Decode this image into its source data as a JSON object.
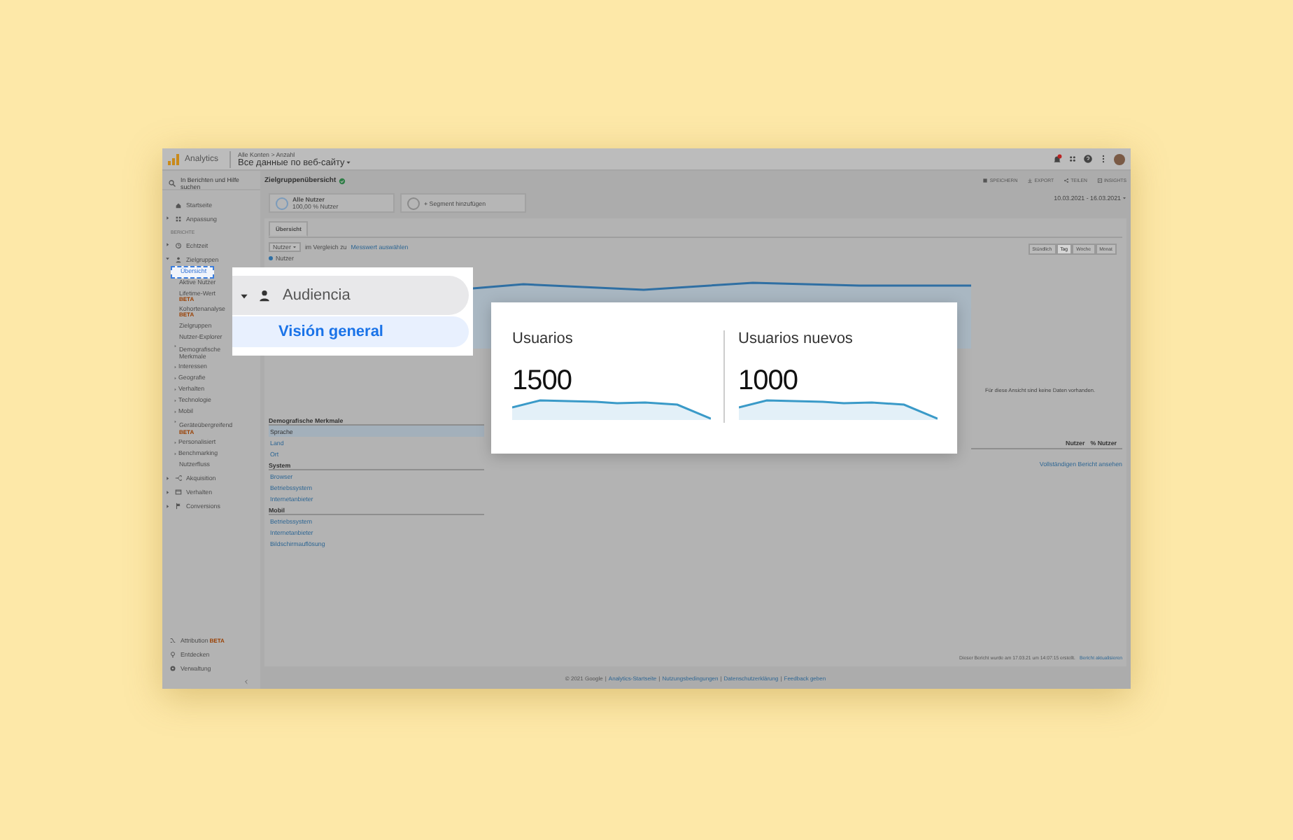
{
  "topbar": {
    "app_name": "Analytics",
    "breadcrumb": "Alle Konten > Anzahl",
    "property": "Все данные по веб-сайту"
  },
  "search": {
    "placeholder": "In Berichten und Hilfe suchen"
  },
  "sidebar": {
    "items": [
      {
        "kind": "item",
        "label": "Startseite",
        "selected": false
      },
      {
        "kind": "item",
        "label": "Anpassung",
        "expanded": false,
        "selected": false
      },
      {
        "kind": "section",
        "label": "BERICHTE"
      },
      {
        "kind": "item",
        "label": "Echtzeit",
        "expanded": false,
        "selected": false
      },
      {
        "kind": "item",
        "label": "Zielgruppen",
        "expanded": true,
        "selected": false,
        "children": [
          {
            "label": "Übersicht",
            "selected": true
          },
          {
            "label": "Aktive Nutzer",
            "selected": false
          },
          {
            "label": "Lifetime-Wert",
            "badge": "BETA",
            "selected": false
          },
          {
            "label": "Kohortenanalyse",
            "badge": "BETA",
            "selected": false
          },
          {
            "label": "Zielgruppen",
            "selected": false
          },
          {
            "label": "Nutzer-Explorer",
            "selected": false
          },
          {
            "label": "Demografische Merkmale",
            "expanded": false,
            "selected": false
          },
          {
            "label": "Interessen",
            "expanded": false,
            "selected": false
          },
          {
            "label": "Geografie",
            "expanded": false,
            "selected": false
          },
          {
            "label": "Verhalten",
            "expanded": false,
            "selected": false
          },
          {
            "label": "Technologie",
            "expanded": false,
            "selected": false
          },
          {
            "label": "Mobil",
            "expanded": false,
            "selected": false
          },
          {
            "label": "Geräteübergreifend",
            "badge": "BETA",
            "expanded": false,
            "selected": false
          },
          {
            "label": "Personalisiert",
            "expanded": false,
            "selected": false
          },
          {
            "label": "Benchmarking",
            "expanded": false,
            "selected": false
          },
          {
            "label": "Nutzerfluss",
            "selected": false
          }
        ]
      },
      {
        "kind": "item",
        "label": "Akquisition",
        "expanded": false,
        "selected": false
      },
      {
        "kind": "item",
        "label": "Verhalten",
        "expanded": false,
        "selected": false
      },
      {
        "kind": "item",
        "label": "Conversions",
        "expanded": false,
        "selected": false
      }
    ],
    "bottom": [
      {
        "label": "Attribution",
        "badge": "BETA"
      },
      {
        "label": "Entdecken"
      },
      {
        "label": "Verwaltung"
      }
    ]
  },
  "report": {
    "title": "Zielgruppenübersicht",
    "verified": true,
    "actions": [
      {
        "label": "SPEICHERN"
      },
      {
        "label": "EXPORT"
      },
      {
        "label": "TEILEN"
      },
      {
        "label": "INSIGHTS"
      }
    ],
    "date_range": "10.03.2021 - 16.03.2021"
  },
  "segments": [
    {
      "kind": "segment",
      "name": "Alle Nutzer",
      "detail": "100,00 % Nutzer"
    },
    {
      "kind": "add",
      "name": "+ Segment hinzufügen"
    }
  ],
  "tabs": [
    {
      "label": "Übersicht",
      "selected": true
    }
  ],
  "metric_select": {
    "value": "Nutzer",
    "compare_text": "im Vergleich zu",
    "compare_link": "Messwert auswählen"
  },
  "legend": "Nutzer",
  "granularity": [
    {
      "label": "Stündlich",
      "selected": false
    },
    {
      "label": "Tag",
      "selected": true
    },
    {
      "label": "Woche",
      "selected": false
    },
    {
      "label": "Monat",
      "selected": false
    }
  ],
  "side_panel": {
    "message": "Für diese Ansicht sind keine Daten vorhanden.",
    "columns": [
      "Nutzer",
      "% Nutzer"
    ],
    "link": "Vollständigen Bericht ansehen"
  },
  "dimensions": {
    "heading": "Demografische Merkmale",
    "groups": [
      {
        "items": [
          {
            "label": "Sprache",
            "selected": true
          },
          {
            "label": "Land",
            "selected": false
          },
          {
            "label": "Ort",
            "selected": false
          }
        ]
      },
      {
        "title": "System",
        "items": [
          {
            "label": "Browser",
            "selected": false
          },
          {
            "label": "Betriebssystem",
            "selected": false
          },
          {
            "label": "Internetanbieter",
            "selected": false
          }
        ]
      },
      {
        "title": "Mobil",
        "items": [
          {
            "label": "Betriebssystem",
            "selected": false
          },
          {
            "label": "Internetanbieter",
            "selected": false
          },
          {
            "label": "Bildschirmauflösung",
            "selected": false
          }
        ]
      }
    ]
  },
  "report_footer": {
    "text": "Dieser Bericht wurde am 17.03.21 um 14:07:15 erstellt.",
    "link": "Bericht aktualisieren"
  },
  "footer": {
    "copyright": "© 2021 Google",
    "separator": "|",
    "links": [
      "Analytics-Startseite",
      "Nutzungsbedingungen",
      "Datenschutzerklärung",
      "Feedback geben"
    ]
  },
  "callout_nav": {
    "section": {
      "label": "Audiencia",
      "expanded": true
    },
    "item": {
      "label": "Visión general",
      "selected": true
    }
  },
  "callout_metrics": [
    {
      "label": "Usuarios",
      "value": "1500"
    },
    {
      "label": "Usuarios nuevos",
      "value": "1000"
    }
  ]
}
